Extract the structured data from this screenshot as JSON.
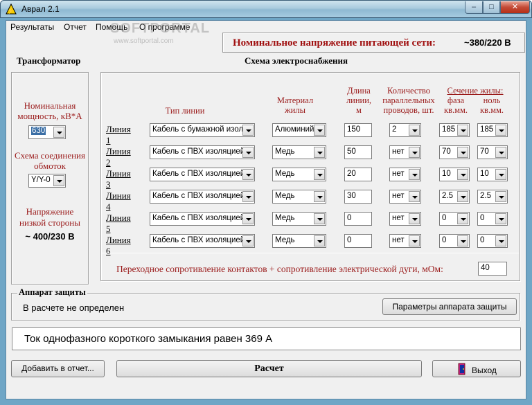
{
  "window": {
    "title": "Аврал 2.1",
    "min_symbol": "–",
    "max_symbol": "□",
    "close_symbol": "✕"
  },
  "menu": [
    "Результаты",
    "Отчет",
    "Помощь",
    "О программе"
  ],
  "watermark": {
    "main": "SOFTPORTAL",
    "sub": "www.softportal.com"
  },
  "network_voltage": {
    "label": "Номинальное напряжение питающей сети:",
    "value": "~380/220 В"
  },
  "transformer": {
    "heading": "Трансформатор",
    "power_label": "Номинальная мощность, кВ*А",
    "power_value": "630",
    "connection_label": "Схема соединения обмоток",
    "connection_value": "Y/Y-0",
    "lv_voltage_label": "Напряжение низкой стороны",
    "lv_voltage_value": "~ 400/230 В"
  },
  "supply_scheme": {
    "heading": "Схема электроснабжения",
    "columns": {
      "line_type": "Тип линии",
      "material": "Материал жилы",
      "length": "Длина линии, м",
      "parallel": "Количество параллельных проводов, шт.",
      "cross_section": "Сечение жилы:",
      "phase": "фаза кв.мм.",
      "neutral": "ноль кв.мм."
    },
    "lines": [
      {
        "label": "Линия 1",
        "type": "Кабель с бумажной изоляцией",
        "material": "Алюминий",
        "length": "150",
        "parallel": "2",
        "phase": "185",
        "neutral": "185"
      },
      {
        "label": "Линия 2",
        "type": "Кабель с ПВХ изоляцией",
        "material": "Медь",
        "length": "50",
        "parallel": "нет",
        "phase": "70",
        "neutral": "70"
      },
      {
        "label": "Линия 3",
        "type": "Кабель с ПВХ изоляцией",
        "material": "Медь",
        "length": "20",
        "parallel": "нет",
        "phase": "10",
        "neutral": "10"
      },
      {
        "label": "Линия 4",
        "type": "Кабель с ПВХ изоляцией",
        "material": "Медь",
        "length": "30",
        "parallel": "нет",
        "phase": "2.5",
        "neutral": "2.5"
      },
      {
        "label": "Линия 5",
        "type": "Кабель с ПВХ изоляцией",
        "material": "Медь",
        "length": "0",
        "parallel": "нет",
        "phase": "0",
        "neutral": "0"
      },
      {
        "label": "Линия 6",
        "type": "Кабель с ПВХ изоляцией",
        "material": "Медь",
        "length": "0",
        "parallel": "нет",
        "phase": "0",
        "neutral": "0"
      }
    ],
    "contact_resistance_label": "Переходное сопротивление контактов + сопротивление электрической дуги, мОм:",
    "contact_resistance_value": "40"
  },
  "protection": {
    "heading": "Аппарат защиты",
    "status": "В расчете не определен",
    "params_button": "Параметры аппарата защиты"
  },
  "result": {
    "text": "Ток однофазного короткого замыкания равен 369 А"
  },
  "buttons": {
    "add_report": "Добавить в отчет...",
    "calculate": "Расчет",
    "exit": "Выход"
  },
  "colors": {
    "accent_red": "#9a1a1a",
    "frame_blue": "#6fa6c6"
  }
}
